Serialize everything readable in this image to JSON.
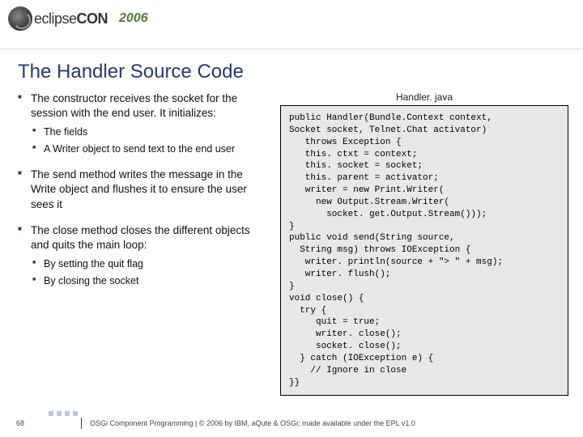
{
  "header": {
    "logo_light": "eclipse",
    "logo_bold": "CON",
    "year": "2006"
  },
  "title": "The Handler Source Code",
  "bullets": {
    "b1": "The constructor receives the socket for the session with the end user. It initializes:",
    "b1a": "The fields",
    "b1b": "A Writer object to send text to the end user",
    "b2": "The send method writes the message in the Write object and flushes it to ensure the user sees it",
    "b3": "The close method closes the different objects and quits the main loop:",
    "b3a": "By setting the quit flag",
    "b3b": "By closing the socket"
  },
  "code": {
    "filename": "Handler. java",
    "body": "public Handler(Bundle.Context context,\nSocket socket, Telnet.Chat activator)\n   throws Exception {\n   this. ctxt = context;\n   this. socket = socket;\n   this. parent = activator;\n   writer = new Print.Writer(\n     new Output.Stream.Writer(\n       socket. get.Output.Stream()));\n}\npublic void send(String source,\n  String msg) throws IOException {\n   writer. println(source + \"> \" + msg);\n   writer. flush();\n}\nvoid close() {\n  try {\n     quit = true;\n     writer. close();\n     socket. close();\n  } catch (IOException e) {\n    // Ignore in close\n}}"
  },
  "footer": {
    "page": "68",
    "text": "OSGi Component Programming | © 2006 by IBM, aQute & OSGi; made available under the EPL v1.0"
  }
}
